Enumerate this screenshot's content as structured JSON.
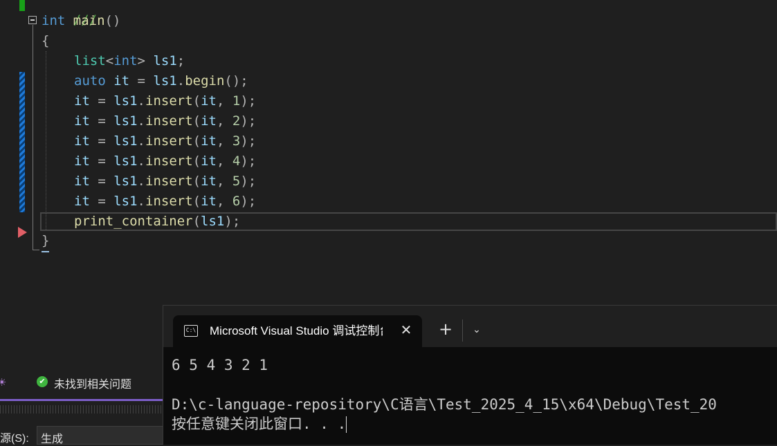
{
  "editor": {
    "top_partial": "///",
    "main_sig": [
      "int",
      " ",
      "main",
      "()"
    ],
    "open_brace": "{",
    "close_brace": "}",
    "decl": {
      "type": "list",
      "lt": "<",
      "targ": "int",
      "gt": ">",
      "name": " ls1",
      "semi": ";"
    },
    "auto_line": {
      "kw": "auto",
      "var": " it",
      "eq": " = ",
      "obj": "ls1",
      "dot": ".",
      "fn": "begin",
      "rest": "();"
    },
    "insert_lines": [
      {
        "lhs": "it",
        "eq": " = ",
        "obj": "ls1",
        "dot": ".",
        "fn": "insert",
        "open": "(",
        "arg": "it",
        "comma": ", ",
        "num": "1",
        "close": ");"
      },
      {
        "lhs": "it",
        "eq": " = ",
        "obj": "ls1",
        "dot": ".",
        "fn": "insert",
        "open": "(",
        "arg": "it",
        "comma": ", ",
        "num": "2",
        "close": ");"
      },
      {
        "lhs": "it",
        "eq": " = ",
        "obj": "ls1",
        "dot": ".",
        "fn": "insert",
        "open": "(",
        "arg": "it",
        "comma": ", ",
        "num": "3",
        "close": ");"
      },
      {
        "lhs": "it",
        "eq": " = ",
        "obj": "ls1",
        "dot": ".",
        "fn": "insert",
        "open": "(",
        "arg": "it",
        "comma": ", ",
        "num": "4",
        "close": ");"
      },
      {
        "lhs": "it",
        "eq": " = ",
        "obj": "ls1",
        "dot": ".",
        "fn": "insert",
        "open": "(",
        "arg": "it",
        "comma": ", ",
        "num": "5",
        "close": ");"
      },
      {
        "lhs": "it",
        "eq": " = ",
        "obj": "ls1",
        "dot": ".",
        "fn": "insert",
        "open": "(",
        "arg": "it",
        "comma": ", ",
        "num": "6",
        "close": ");"
      }
    ],
    "print_line": {
      "fn": "print_container",
      "open": "(",
      "arg": "ls1",
      "close": ");"
    }
  },
  "error_list": {
    "status_text": "未找到相关问题",
    "status_icon": "check-circle-icon"
  },
  "output_panel": {
    "source_label": "源(S):",
    "source_value": "生成"
  },
  "terminal": {
    "tab_title": "Microsoft Visual Studio 调试控制台",
    "tab_icon_text": "C:\\",
    "close_glyph": "✕",
    "new_tab_glyph": "+",
    "dropdown_glyph": "⌄",
    "output_lines": [
      "6 5 4 3 2 1",
      "",
      "D:\\c-language-repository\\C语言\\Test_2025_4_15\\x64\\Debug\\Test_20",
      "按任意键关闭此窗口. . ."
    ]
  }
}
